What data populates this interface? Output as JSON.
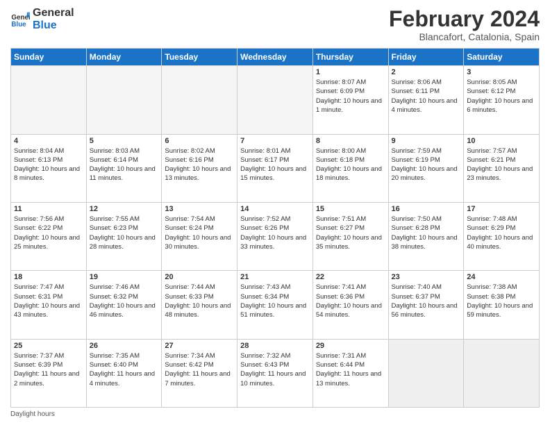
{
  "header": {
    "logo": {
      "line1": "General",
      "line2": "Blue"
    },
    "title": "February 2024",
    "subtitle": "Blancafort, Catalonia, Spain"
  },
  "calendar": {
    "headers": [
      "Sunday",
      "Monday",
      "Tuesday",
      "Wednesday",
      "Thursday",
      "Friday",
      "Saturday"
    ],
    "rows": [
      [
        {
          "day": "",
          "info": "",
          "empty": true
        },
        {
          "day": "",
          "info": "",
          "empty": true
        },
        {
          "day": "",
          "info": "",
          "empty": true
        },
        {
          "day": "",
          "info": "",
          "empty": true
        },
        {
          "day": "1",
          "info": "Sunrise: 8:07 AM\nSunset: 6:09 PM\nDaylight: 10 hours and 1 minute."
        },
        {
          "day": "2",
          "info": "Sunrise: 8:06 AM\nSunset: 6:11 PM\nDaylight: 10 hours and 4 minutes."
        },
        {
          "day": "3",
          "info": "Sunrise: 8:05 AM\nSunset: 6:12 PM\nDaylight: 10 hours and 6 minutes."
        }
      ],
      [
        {
          "day": "4",
          "info": "Sunrise: 8:04 AM\nSunset: 6:13 PM\nDaylight: 10 hours and 8 minutes."
        },
        {
          "day": "5",
          "info": "Sunrise: 8:03 AM\nSunset: 6:14 PM\nDaylight: 10 hours and 11 minutes."
        },
        {
          "day": "6",
          "info": "Sunrise: 8:02 AM\nSunset: 6:16 PM\nDaylight: 10 hours and 13 minutes."
        },
        {
          "day": "7",
          "info": "Sunrise: 8:01 AM\nSunset: 6:17 PM\nDaylight: 10 hours and 15 minutes."
        },
        {
          "day": "8",
          "info": "Sunrise: 8:00 AM\nSunset: 6:18 PM\nDaylight: 10 hours and 18 minutes."
        },
        {
          "day": "9",
          "info": "Sunrise: 7:59 AM\nSunset: 6:19 PM\nDaylight: 10 hours and 20 minutes."
        },
        {
          "day": "10",
          "info": "Sunrise: 7:57 AM\nSunset: 6:21 PM\nDaylight: 10 hours and 23 minutes."
        }
      ],
      [
        {
          "day": "11",
          "info": "Sunrise: 7:56 AM\nSunset: 6:22 PM\nDaylight: 10 hours and 25 minutes."
        },
        {
          "day": "12",
          "info": "Sunrise: 7:55 AM\nSunset: 6:23 PM\nDaylight: 10 hours and 28 minutes."
        },
        {
          "day": "13",
          "info": "Sunrise: 7:54 AM\nSunset: 6:24 PM\nDaylight: 10 hours and 30 minutes."
        },
        {
          "day": "14",
          "info": "Sunrise: 7:52 AM\nSunset: 6:26 PM\nDaylight: 10 hours and 33 minutes."
        },
        {
          "day": "15",
          "info": "Sunrise: 7:51 AM\nSunset: 6:27 PM\nDaylight: 10 hours and 35 minutes."
        },
        {
          "day": "16",
          "info": "Sunrise: 7:50 AM\nSunset: 6:28 PM\nDaylight: 10 hours and 38 minutes."
        },
        {
          "day": "17",
          "info": "Sunrise: 7:48 AM\nSunset: 6:29 PM\nDaylight: 10 hours and 40 minutes."
        }
      ],
      [
        {
          "day": "18",
          "info": "Sunrise: 7:47 AM\nSunset: 6:31 PM\nDaylight: 10 hours and 43 minutes."
        },
        {
          "day": "19",
          "info": "Sunrise: 7:46 AM\nSunset: 6:32 PM\nDaylight: 10 hours and 46 minutes."
        },
        {
          "day": "20",
          "info": "Sunrise: 7:44 AM\nSunset: 6:33 PM\nDaylight: 10 hours and 48 minutes."
        },
        {
          "day": "21",
          "info": "Sunrise: 7:43 AM\nSunset: 6:34 PM\nDaylight: 10 hours and 51 minutes."
        },
        {
          "day": "22",
          "info": "Sunrise: 7:41 AM\nSunset: 6:36 PM\nDaylight: 10 hours and 54 minutes."
        },
        {
          "day": "23",
          "info": "Sunrise: 7:40 AM\nSunset: 6:37 PM\nDaylight: 10 hours and 56 minutes."
        },
        {
          "day": "24",
          "info": "Sunrise: 7:38 AM\nSunset: 6:38 PM\nDaylight: 10 hours and 59 minutes."
        }
      ],
      [
        {
          "day": "25",
          "info": "Sunrise: 7:37 AM\nSunset: 6:39 PM\nDaylight: 11 hours and 2 minutes.",
          "lastrow": true
        },
        {
          "day": "26",
          "info": "Sunrise: 7:35 AM\nSunset: 6:40 PM\nDaylight: 11 hours and 4 minutes.",
          "lastrow": true
        },
        {
          "day": "27",
          "info": "Sunrise: 7:34 AM\nSunset: 6:42 PM\nDaylight: 11 hours and 7 minutes.",
          "lastrow": true
        },
        {
          "day": "28",
          "info": "Sunrise: 7:32 AM\nSunset: 6:43 PM\nDaylight: 11 hours and 10 minutes.",
          "lastrow": true
        },
        {
          "day": "29",
          "info": "Sunrise: 7:31 AM\nSunset: 6:44 PM\nDaylight: 11 hours and 13 minutes.",
          "lastrow": true
        },
        {
          "day": "",
          "info": "",
          "empty": true,
          "lastrow": true
        },
        {
          "day": "",
          "info": "",
          "empty": true,
          "lastrow": true
        }
      ]
    ]
  },
  "footer": {
    "daylight_label": "Daylight hours"
  }
}
